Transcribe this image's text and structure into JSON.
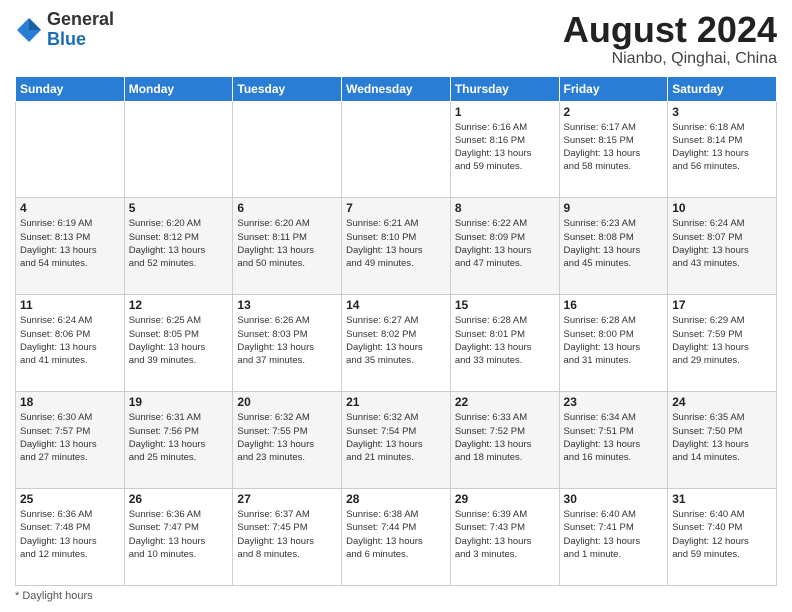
{
  "header": {
    "logo_general": "General",
    "logo_blue": "Blue",
    "month_year": "August 2024",
    "location": "Nianbo, Qinghai, China"
  },
  "footer": {
    "note": "Daylight hours"
  },
  "days_of_week": [
    "Sunday",
    "Monday",
    "Tuesday",
    "Wednesday",
    "Thursday",
    "Friday",
    "Saturday"
  ],
  "weeks": [
    [
      {
        "day": "",
        "info": ""
      },
      {
        "day": "",
        "info": ""
      },
      {
        "day": "",
        "info": ""
      },
      {
        "day": "",
        "info": ""
      },
      {
        "day": "1",
        "info": "Sunrise: 6:16 AM\nSunset: 8:16 PM\nDaylight: 13 hours\nand 59 minutes."
      },
      {
        "day": "2",
        "info": "Sunrise: 6:17 AM\nSunset: 8:15 PM\nDaylight: 13 hours\nand 58 minutes."
      },
      {
        "day": "3",
        "info": "Sunrise: 6:18 AM\nSunset: 8:14 PM\nDaylight: 13 hours\nand 56 minutes."
      }
    ],
    [
      {
        "day": "4",
        "info": "Sunrise: 6:19 AM\nSunset: 8:13 PM\nDaylight: 13 hours\nand 54 minutes."
      },
      {
        "day": "5",
        "info": "Sunrise: 6:20 AM\nSunset: 8:12 PM\nDaylight: 13 hours\nand 52 minutes."
      },
      {
        "day": "6",
        "info": "Sunrise: 6:20 AM\nSunset: 8:11 PM\nDaylight: 13 hours\nand 50 minutes."
      },
      {
        "day": "7",
        "info": "Sunrise: 6:21 AM\nSunset: 8:10 PM\nDaylight: 13 hours\nand 49 minutes."
      },
      {
        "day": "8",
        "info": "Sunrise: 6:22 AM\nSunset: 8:09 PM\nDaylight: 13 hours\nand 47 minutes."
      },
      {
        "day": "9",
        "info": "Sunrise: 6:23 AM\nSunset: 8:08 PM\nDaylight: 13 hours\nand 45 minutes."
      },
      {
        "day": "10",
        "info": "Sunrise: 6:24 AM\nSunset: 8:07 PM\nDaylight: 13 hours\nand 43 minutes."
      }
    ],
    [
      {
        "day": "11",
        "info": "Sunrise: 6:24 AM\nSunset: 8:06 PM\nDaylight: 13 hours\nand 41 minutes."
      },
      {
        "day": "12",
        "info": "Sunrise: 6:25 AM\nSunset: 8:05 PM\nDaylight: 13 hours\nand 39 minutes."
      },
      {
        "day": "13",
        "info": "Sunrise: 6:26 AM\nSunset: 8:03 PM\nDaylight: 13 hours\nand 37 minutes."
      },
      {
        "day": "14",
        "info": "Sunrise: 6:27 AM\nSunset: 8:02 PM\nDaylight: 13 hours\nand 35 minutes."
      },
      {
        "day": "15",
        "info": "Sunrise: 6:28 AM\nSunset: 8:01 PM\nDaylight: 13 hours\nand 33 minutes."
      },
      {
        "day": "16",
        "info": "Sunrise: 6:28 AM\nSunset: 8:00 PM\nDaylight: 13 hours\nand 31 minutes."
      },
      {
        "day": "17",
        "info": "Sunrise: 6:29 AM\nSunset: 7:59 PM\nDaylight: 13 hours\nand 29 minutes."
      }
    ],
    [
      {
        "day": "18",
        "info": "Sunrise: 6:30 AM\nSunset: 7:57 PM\nDaylight: 13 hours\nand 27 minutes."
      },
      {
        "day": "19",
        "info": "Sunrise: 6:31 AM\nSunset: 7:56 PM\nDaylight: 13 hours\nand 25 minutes."
      },
      {
        "day": "20",
        "info": "Sunrise: 6:32 AM\nSunset: 7:55 PM\nDaylight: 13 hours\nand 23 minutes."
      },
      {
        "day": "21",
        "info": "Sunrise: 6:32 AM\nSunset: 7:54 PM\nDaylight: 13 hours\nand 21 minutes."
      },
      {
        "day": "22",
        "info": "Sunrise: 6:33 AM\nSunset: 7:52 PM\nDaylight: 13 hours\nand 18 minutes."
      },
      {
        "day": "23",
        "info": "Sunrise: 6:34 AM\nSunset: 7:51 PM\nDaylight: 13 hours\nand 16 minutes."
      },
      {
        "day": "24",
        "info": "Sunrise: 6:35 AM\nSunset: 7:50 PM\nDaylight: 13 hours\nand 14 minutes."
      }
    ],
    [
      {
        "day": "25",
        "info": "Sunrise: 6:36 AM\nSunset: 7:48 PM\nDaylight: 13 hours\nand 12 minutes."
      },
      {
        "day": "26",
        "info": "Sunrise: 6:36 AM\nSunset: 7:47 PM\nDaylight: 13 hours\nand 10 minutes."
      },
      {
        "day": "27",
        "info": "Sunrise: 6:37 AM\nSunset: 7:45 PM\nDaylight: 13 hours\nand 8 minutes."
      },
      {
        "day": "28",
        "info": "Sunrise: 6:38 AM\nSunset: 7:44 PM\nDaylight: 13 hours\nand 6 minutes."
      },
      {
        "day": "29",
        "info": "Sunrise: 6:39 AM\nSunset: 7:43 PM\nDaylight: 13 hours\nand 3 minutes."
      },
      {
        "day": "30",
        "info": "Sunrise: 6:40 AM\nSunset: 7:41 PM\nDaylight: 13 hours\nand 1 minute."
      },
      {
        "day": "31",
        "info": "Sunrise: 6:40 AM\nSunset: 7:40 PM\nDaylight: 12 hours\nand 59 minutes."
      }
    ]
  ]
}
